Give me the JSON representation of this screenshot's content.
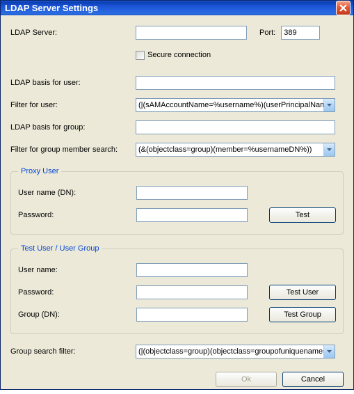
{
  "window": {
    "title": "LDAP Server Settings"
  },
  "server": {
    "label": "LDAP Server:",
    "value": "",
    "port_label": "Port:",
    "port_value": "389",
    "secure_label": "Secure connection"
  },
  "basis_user": {
    "label": "LDAP basis for user:",
    "value": ""
  },
  "filter_user": {
    "label": "Filter for user:",
    "value": "(|(sAMAccountName=%username%)(userPrincipalName=%"
  },
  "basis_group": {
    "label": "LDAP basis for group:",
    "value": ""
  },
  "filter_member": {
    "label": "Filter for group member search:",
    "value": "(&(objectclass=group)(member=%usernameDN%))"
  },
  "proxy": {
    "legend": "Proxy User",
    "user_label": "User name (DN):",
    "user_value": "",
    "pass_label": "Password:",
    "pass_value": "",
    "test_label": "Test"
  },
  "testuser": {
    "legend": "Test User / User Group",
    "user_label": "User name:",
    "user_value": "",
    "pass_label": "Password:",
    "pass_value": "",
    "group_label": "Group (DN):",
    "group_value": "",
    "test_user_label": "Test User",
    "test_group_label": "Test Group"
  },
  "group_search": {
    "label": "Group search filter:",
    "value": "(|(objectclass=group)(objectclass=groupofuniquenames))"
  },
  "footer": {
    "ok": "Ok",
    "cancel": "Cancel"
  }
}
